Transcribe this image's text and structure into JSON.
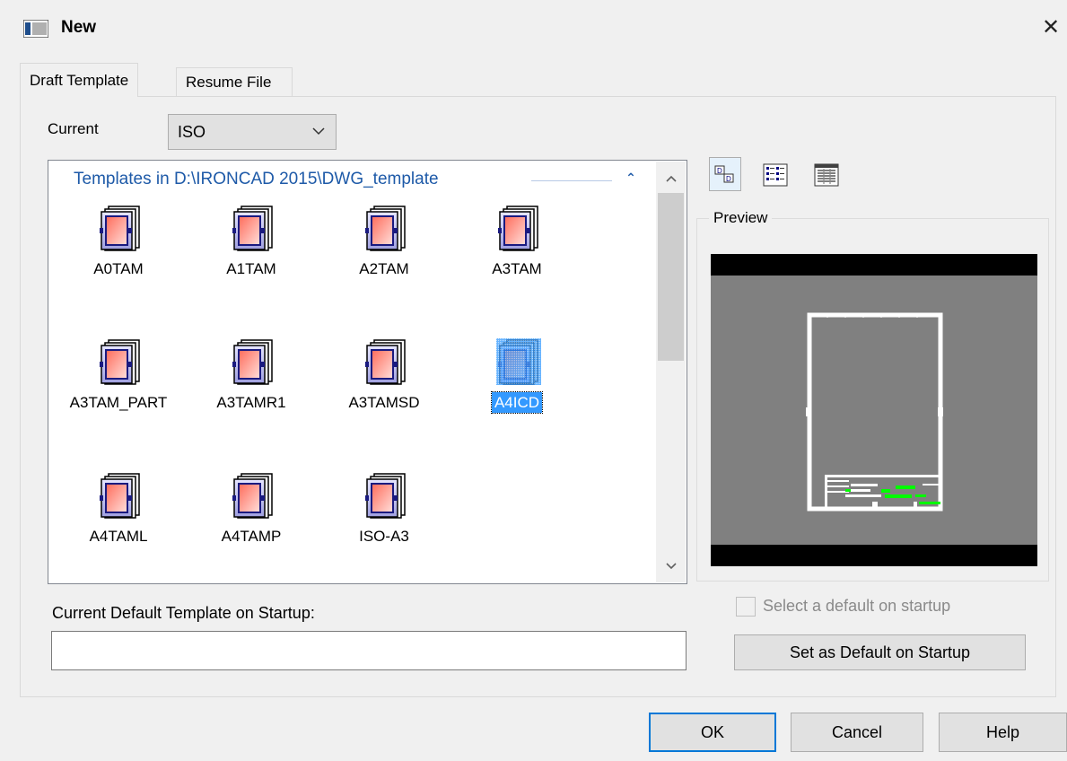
{
  "window": {
    "title": "New",
    "close_glyph": "✕"
  },
  "tabs": [
    {
      "label": "Draft Template",
      "active": true
    },
    {
      "label": "Resume File",
      "active": false
    }
  ],
  "current": {
    "label": "Current",
    "value": "ISO"
  },
  "template_list": {
    "header": "Templates in D:\\IRONCAD 2015\\DWG_template",
    "collapse_glyph": "⌃",
    "items": [
      {
        "label": "A0TAM",
        "selected": false
      },
      {
        "label": "A1TAM",
        "selected": false
      },
      {
        "label": "A2TAM",
        "selected": false
      },
      {
        "label": "A3TAM",
        "selected": false
      },
      {
        "label": "A3TAM_PART",
        "selected": false
      },
      {
        "label": "A3TAMR1",
        "selected": false
      },
      {
        "label": "A3TAMSD",
        "selected": false
      },
      {
        "label": "A4ICD",
        "selected": true
      },
      {
        "label": "A4TAML",
        "selected": false
      },
      {
        "label": "A4TAMP",
        "selected": false
      },
      {
        "label": "ISO-A3",
        "selected": false
      }
    ]
  },
  "view_modes": [
    {
      "icon": "large-icons-view-icon",
      "active": true
    },
    {
      "icon": "list-view-icon",
      "active": false
    },
    {
      "icon": "details-view-icon",
      "active": false
    }
  ],
  "preview": {
    "label": "Preview"
  },
  "default_on_startup": {
    "checkbox_label": "Select a default on startup",
    "checked": false,
    "enabled": false,
    "button_label": "Set as Default on Startup"
  },
  "startup_template": {
    "label": "Current Default Template on Startup:",
    "value": ""
  },
  "buttons": {
    "ok": "OK",
    "cancel": "Cancel",
    "help": "Help"
  },
  "colors": {
    "accent": "#0078d7",
    "selection": "#3399ff",
    "header_text": "#1e5aa8",
    "preview_bg": "#808080",
    "title_block_green": "#00ff00"
  }
}
